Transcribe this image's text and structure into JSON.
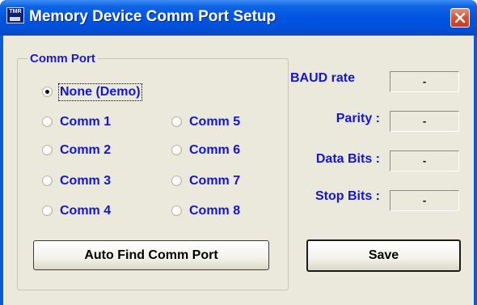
{
  "window": {
    "title": "Memory Device Comm Port Setup",
    "icon_text": "TMR",
    "accent_color": "#0054e3",
    "label_color": "#1414d8"
  },
  "comm_port": {
    "group_label": "Comm Port",
    "selected": "None (Demo)",
    "options": [
      "None (Demo)",
      "Comm 1",
      "Comm 2",
      "Comm 3",
      "Comm 4",
      "Comm 5",
      "Comm 6",
      "Comm 7",
      "Comm 8"
    ]
  },
  "settings": {
    "baud_label": "BAUD rate",
    "baud_value": "-",
    "parity_label": "Parity :",
    "parity_value": "-",
    "data_bits_label": "Data Bits :",
    "data_bits_value": "-",
    "stop_bits_label": "Stop Bits :",
    "stop_bits_value": "-"
  },
  "buttons": {
    "auto_find_label": "Auto Find Comm Port",
    "save_label": "Save"
  }
}
